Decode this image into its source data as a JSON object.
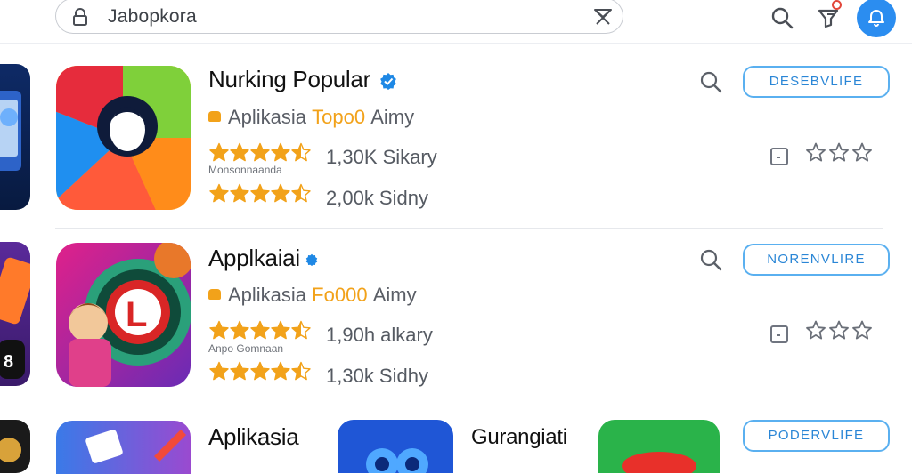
{
  "search": {
    "query": "Jabopkora"
  },
  "rows": [
    {
      "title": "Nurking Popular",
      "line_prefix": "Aplikasia",
      "line_highlight": "Topo0",
      "line_suffix": "Aimy",
      "rating1": 4.5,
      "count1": "1,30K Sikary",
      "tiny_label": "Monsonnaanda",
      "rating2": 4.5,
      "count2": "2,00k Sidny",
      "button_label": "DESEBVLIFE",
      "right_rating": 0
    },
    {
      "title": "Applkaiai",
      "line_prefix": "Aplikasia",
      "line_highlight": "Fo000",
      "line_suffix": "Aimy",
      "rating1": 4.5,
      "count1": "1,90h alkary",
      "tiny_label": "Anpo Gomnaan",
      "rating2": 4.5,
      "count2": "1,30k Sidhy",
      "button_label": "NORENVLIRE",
      "right_rating": 0
    }
  ],
  "row3": {
    "title": "Aplikasia",
    "title_b": "Gurangiati",
    "button_label": "PODERVLIFE"
  },
  "peek_badge": "8",
  "colors": {
    "accent": "#2b8df0",
    "button_border": "#5ab0f0",
    "star": "#f2a21a",
    "verified": "#1e88e5"
  },
  "icons": [
    "lock-icon",
    "clear-icon",
    "search-icon",
    "filter-icon",
    "bell-icon",
    "verified-icon",
    "star-icon",
    "checkbox-icon"
  ]
}
